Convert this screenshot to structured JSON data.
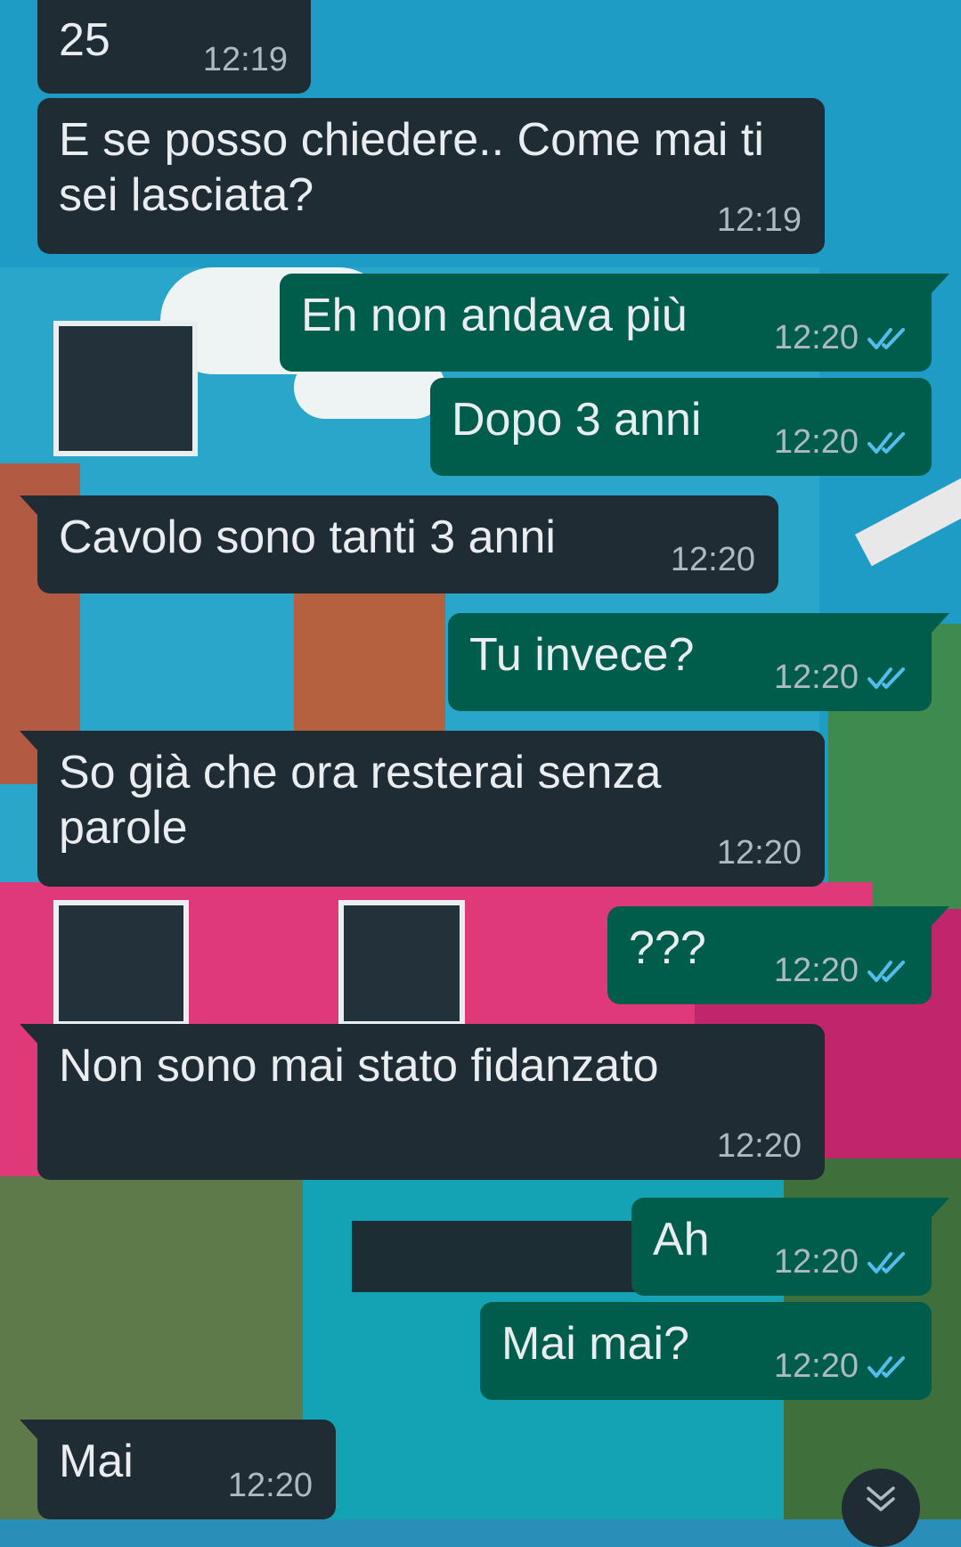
{
  "messages": [
    {
      "dir": "in",
      "text": "25",
      "time": "12:19"
    },
    {
      "dir": "in",
      "text": "E se posso chiedere.. Come mai ti sei lasciata?",
      "time": "12:19"
    },
    {
      "dir": "out",
      "text": "Eh non andava più",
      "time": "12:20"
    },
    {
      "dir": "out",
      "text": "Dopo 3 anni",
      "time": "12:20"
    },
    {
      "dir": "in",
      "text": "Cavolo sono tanti 3 anni",
      "time": "12:20"
    },
    {
      "dir": "out",
      "text": "Tu invece?",
      "time": "12:20"
    },
    {
      "dir": "in",
      "text": "So già che ora resterai senza parole",
      "time": "12:20"
    },
    {
      "dir": "out",
      "text": "???",
      "time": "12:20"
    },
    {
      "dir": "in",
      "text": "Non sono mai stato fidanzato",
      "time": "12:20"
    },
    {
      "dir": "out",
      "text": "Ah",
      "time": "12:20"
    },
    {
      "dir": "out",
      "text": "Mai mai?",
      "time": "12:20"
    },
    {
      "dir": "in",
      "text": "Mai",
      "time": "12:20"
    }
  ],
  "colors": {
    "incoming_bubble": "#1f2c34",
    "outgoing_bubble": "#005c4b",
    "read_tick": "#53bdeb"
  },
  "icons": {
    "read_receipt": "double-check-icon",
    "scroll_down": "chevron-double-down-icon"
  }
}
